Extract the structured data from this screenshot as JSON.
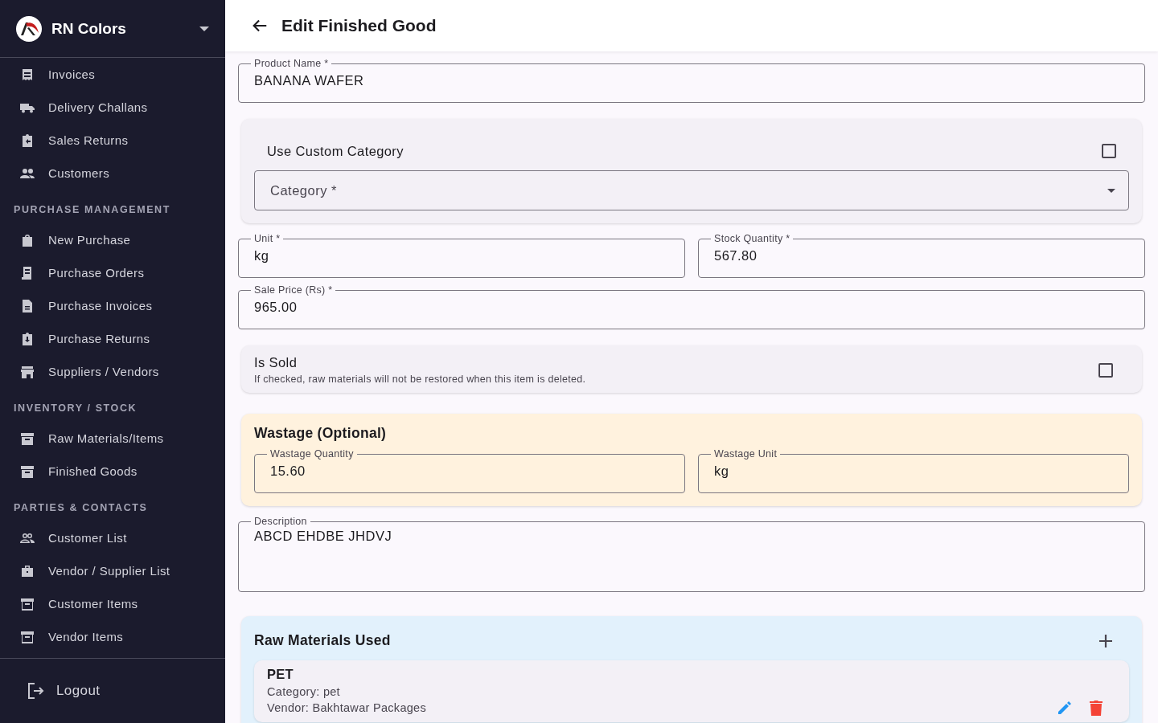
{
  "sidebar": {
    "brand": "RN Colors",
    "sections": [
      {
        "items": [
          {
            "label": "Invoices"
          },
          {
            "label": "Delivery Challans"
          },
          {
            "label": "Sales Returns"
          },
          {
            "label": "Customers"
          }
        ]
      },
      {
        "heading": "PURCHASE MANAGEMENT",
        "items": [
          {
            "label": "New Purchase"
          },
          {
            "label": "Purchase Orders"
          },
          {
            "label": "Purchase Invoices"
          },
          {
            "label": "Purchase Returns"
          },
          {
            "label": "Suppliers / Vendors"
          }
        ]
      },
      {
        "heading": "INVENTORY / STOCK",
        "items": [
          {
            "label": "Raw Materials/Items"
          },
          {
            "label": "Finished Goods"
          }
        ]
      },
      {
        "heading": "PARTIES & CONTACTS",
        "items": [
          {
            "label": "Customer List"
          },
          {
            "label": "Vendor / Supplier List"
          },
          {
            "label": "Customer Items"
          },
          {
            "label": "Vendor Items"
          }
        ]
      }
    ],
    "logout": "Logout"
  },
  "header": {
    "title": "Edit Finished Good"
  },
  "form": {
    "product_name": {
      "label": "Product Name *",
      "value": "BANANA WAFER"
    },
    "custom_category": {
      "label": "Use Custom Category",
      "checked": false,
      "select": {
        "placeholder": "Category *"
      }
    },
    "unit": {
      "label": "Unit *",
      "value": "kg"
    },
    "stock_quantity": {
      "label": "Stock Quantity *",
      "value": "567.80"
    },
    "sale_price": {
      "label": "Sale Price (Rs) *",
      "value": "965.00"
    },
    "is_sold": {
      "label": "Is Sold",
      "hint": "If checked, raw materials will not be restored when this item is deleted.",
      "checked": false
    },
    "wastage": {
      "title": "Wastage (Optional)",
      "fields": [
        {
          "label": "Wastage Quantity",
          "value": "15.60"
        },
        {
          "label": "Wastage Unit",
          "value": "kg"
        }
      ]
    },
    "description": {
      "label": "Description",
      "value": "ABCD EHDBE JHDVJ"
    },
    "raw_materials": {
      "title": "Raw Materials Used",
      "items": [
        {
          "name": "PET",
          "category": "Category: pet",
          "vendor": "Vendor: Bakhtawar Packages"
        }
      ]
    }
  }
}
